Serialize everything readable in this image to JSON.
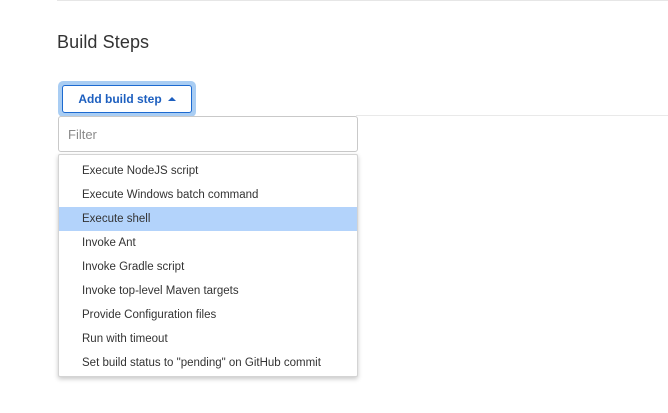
{
  "section": {
    "title": "Build Steps"
  },
  "add_button": {
    "label": "Add build step"
  },
  "filter": {
    "placeholder": "Filter",
    "value": ""
  },
  "menu": {
    "selected_index": 2,
    "items": [
      {
        "label": "Execute NodeJS script"
      },
      {
        "label": "Execute Windows batch command"
      },
      {
        "label": "Execute shell"
      },
      {
        "label": "Invoke Ant"
      },
      {
        "label": "Invoke Gradle script"
      },
      {
        "label": "Invoke top-level Maven targets"
      },
      {
        "label": "Provide Configuration files"
      },
      {
        "label": "Run with timeout"
      },
      {
        "label": "Set build status to \"pending\" on GitHub commit"
      }
    ]
  },
  "colors": {
    "accent": "#1d5fbf",
    "focus_ring": "#a9cdf3",
    "selected_bg": "#b3d3fb"
  },
  "icons": {
    "add_button_caret": "caret-up-icon"
  }
}
